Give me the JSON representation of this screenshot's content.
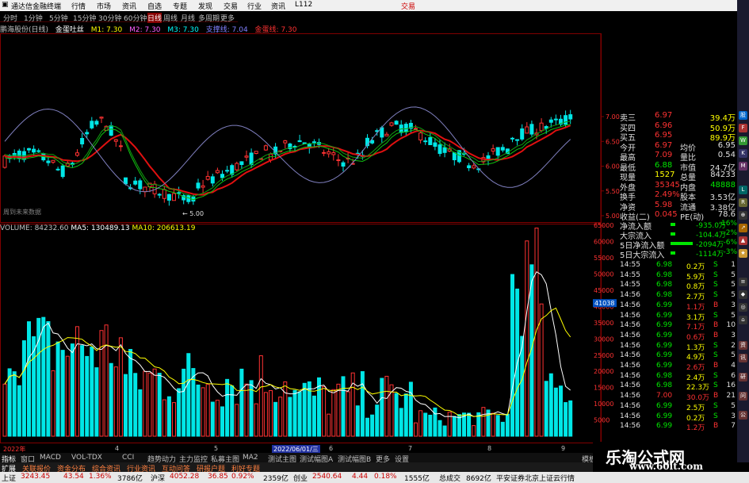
{
  "app": {
    "title": "通达信金融终端",
    "menus": [
      "行情",
      "市场",
      "资讯",
      "自选",
      "专题",
      "发现",
      "交易",
      "行业",
      "资讯",
      "L112"
    ],
    "right_label": "交易"
  },
  "periods": [
    "分时",
    "1分钟",
    "5分钟",
    "15分钟",
    "30分钟",
    "60分钟",
    "日线",
    "周线",
    "月线",
    "多周期",
    "更多"
  ],
  "active_period": "日线",
  "indicator_bar": {
    "name": "鹏海股份(日线)",
    "formula": "金蛋吐丝",
    "m1": "M1: 7.30",
    "m2": "M2: 7.30",
    "m3": "M3: 7.30",
    "line1": "支撑线: 7.04",
    "line2": "金蛋线: 7.30"
  },
  "volume_bar": {
    "label": "VOLUME: 84232.60",
    "ma5": "MA5: 130489.13",
    "ma10": "MA10: 206613.19"
  },
  "price_axis": [
    "7.00",
    "6.50",
    "6.00",
    "5.50",
    "5.00"
  ],
  "vol_axis": [
    "65000",
    "60000",
    "55000",
    "50000",
    "45000",
    "40000",
    "35000",
    "30000",
    "25000",
    "20000",
    "15000",
    "10000",
    "5000"
  ],
  "vol_marker": "41038",
  "low_marker": "5.00",
  "chart_note": "周到未来数据",
  "time_axis": [
    "2022年",
    "4",
    "5",
    "6",
    "7",
    "8",
    "9"
  ],
  "date_cursor": "2022/06/01/三",
  "quote": {
    "rows": [
      {
        "l": "卖三",
        "p": "6.97",
        "v": "39.4万"
      },
      {
        "l": "买四",
        "p": "6.96",
        "v": "50.9万"
      },
      {
        "l": "买五",
        "p": "6.95",
        "v": "89.9万"
      },
      {
        "l": "今开",
        "p": "6.97",
        "l2": "均价",
        "v": "6.95"
      },
      {
        "l": "最高",
        "p": "7.09",
        "l2": "量比",
        "v": "0.54"
      },
      {
        "l": "最低",
        "p": "6.88",
        "l2": "市值",
        "v": "24.7亿"
      },
      {
        "l": "现量",
        "p": "1527",
        "l2": "总量",
        "v": "84233"
      },
      {
        "l": "外盘",
        "p": "35345",
        "l2": "内盘",
        "v": "48888"
      },
      {
        "l": "换手",
        "p": "2.49%",
        "l2": "股本",
        "v": "3.53亿"
      },
      {
        "l": "净资",
        "p": "5.98",
        "l2": "流通",
        "v": "3.38亿"
      },
      {
        "l": "收益(二)",
        "p": "0.045",
        "l2": "PE(动)",
        "v": "78.6"
      }
    ]
  },
  "fund_flow": [
    {
      "l": "净流入额",
      "v": "-935.0万",
      "pct": "-16%"
    },
    {
      "l": "大宗流入",
      "v": "-104.4万",
      "pct": "-2%"
    },
    {
      "l": "5日净流入额",
      "v": "-2094万",
      "pct": "-6%"
    },
    {
      "l": "5日大宗流入",
      "v": "-1114万",
      "pct": "-3%"
    }
  ],
  "ticks": [
    {
      "t": "14:55",
      "p": "6.98",
      "v": "0.2万",
      "d": "S",
      "n": "1"
    },
    {
      "t": "14:55",
      "p": "6.98",
      "v": "5.9万",
      "d": "S",
      "n": "5"
    },
    {
      "t": "14:55",
      "p": "6.98",
      "v": "0.8万",
      "d": "S",
      "n": "5"
    },
    {
      "t": "14:56",
      "p": "6.98",
      "v": "2.7万",
      "d": "S",
      "n": "5"
    },
    {
      "t": "14:56",
      "p": "6.99",
      "v": "1.1万",
      "d": "B",
      "n": "3"
    },
    {
      "t": "14:56",
      "p": "6.99",
      "v": "3.1万",
      "d": "S",
      "n": "5"
    },
    {
      "t": "14:56",
      "p": "6.99",
      "v": "7.1万",
      "d": "B",
      "n": "10"
    },
    {
      "t": "14:56",
      "p": "6.99",
      "v": "0.6万",
      "d": "B",
      "n": "3"
    },
    {
      "t": "14:56",
      "p": "6.99",
      "v": "1.3万",
      "d": "S",
      "n": "2"
    },
    {
      "t": "14:56",
      "p": "6.99",
      "v": "4.9万",
      "d": "S",
      "n": "5"
    },
    {
      "t": "14:56",
      "p": "6.99",
      "v": "2.6万",
      "d": "B",
      "n": "4"
    },
    {
      "t": "14:56",
      "p": "6.98",
      "v": "2.4万",
      "d": "S",
      "n": "6"
    },
    {
      "t": "14:56",
      "p": "6.98",
      "v": "22.3万",
      "d": "S",
      "n": "16"
    },
    {
      "t": "14:56",
      "p": "7.00",
      "v": "30.0万",
      "d": "B",
      "n": "21"
    },
    {
      "t": "14:56",
      "p": "6.99",
      "v": "2.5万",
      "d": "S",
      "n": "5"
    },
    {
      "t": "14:56",
      "p": "6.99",
      "v": "0.2万",
      "d": "S",
      "n": "3"
    },
    {
      "t": "14:56",
      "p": "6.99",
      "v": "1.2万",
      "d": "B",
      "n": "7"
    }
  ],
  "bottom_tabs": [
    "指标",
    "窗口",
    "MACD",
    "VOL-TDX",
    "CCI",
    "趋势动力",
    "主力监控",
    "私募主图",
    "MA2",
    "测试主图",
    "测试幅图A",
    "测试幅图B",
    "更多",
    "设置"
  ],
  "bottom_tabs2": [
    "扩展",
    "关联报价",
    "资金分布",
    "综合资讯",
    "行业资讯",
    "互动问答",
    "研报户题",
    "利好专题"
  ],
  "right_corner": "模板",
  "status": {
    "sh_label": "上证",
    "sh_val": "3243.45",
    "sh_chg": "43.54",
    "sh_pct": "1.36%",
    "sh_amt": "3786亿",
    "sz_label": "沪深",
    "sz_val": "4052.28",
    "sz_chg": "36.85",
    "sz_pct": "0.92%",
    "sz_amt": "2359亿",
    "cy_label": "创业",
    "cy_val": "2540.64",
    "cy_chg": "4.44",
    "cy_pct": "0.18%",
    "cy_amt": "1555亿",
    "total_label": "总成交",
    "total_amt": "8692亿",
    "broker": "平安证券北京上证云行情"
  },
  "watermark": {
    "line1": "乐淘公式网",
    "line2": "www.60lt.com"
  },
  "colors": {
    "up": "#ff3232",
    "down": "#00e6e6",
    "bg": "#000000",
    "ma_red": "#e01010",
    "ma_green": "#10c010",
    "ma_white": "#c0c0ff"
  }
}
